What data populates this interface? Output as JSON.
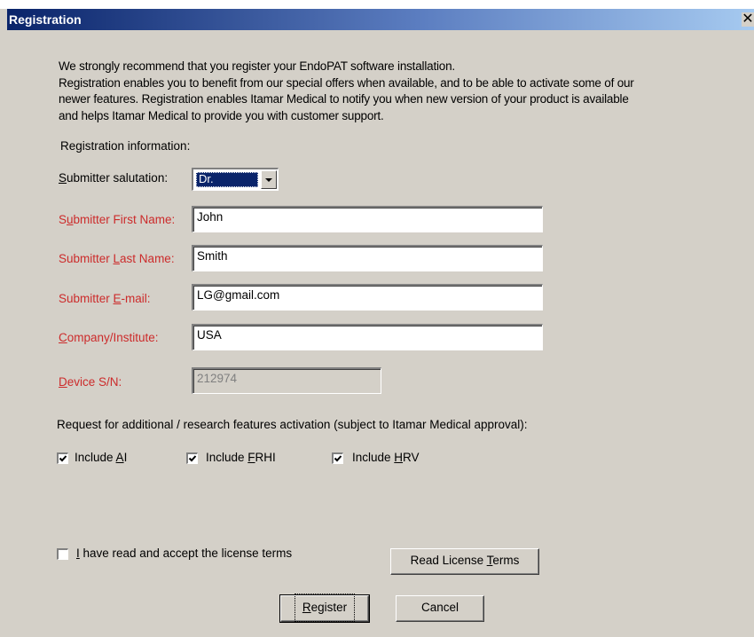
{
  "window": {
    "title": "Registration",
    "close_glyph": "✕"
  },
  "intro": {
    "lines": [
      "We strongly recommend that you register your EndoPAT software installation.",
      "Registration enables you to benefit from our special offers when available, and to be able to activate some of our",
      "newer features. Registration enables Itamar Medical to notify you when new version of your product is available",
      "and helps Itamar Medical to provide you with customer support."
    ]
  },
  "section": {
    "registration_info": "Registration information:"
  },
  "form": {
    "salutation": {
      "label_pre": "",
      "label_ul": "S",
      "label_post": "ubmitter salutation:",
      "value": "Dr."
    },
    "first_name": {
      "label_pre": "S",
      "label_ul": "u",
      "label_post": "bmitter First Name:",
      "value": "John"
    },
    "last_name": {
      "label_pre": "Submitter ",
      "label_ul": "L",
      "label_post": "ast Name:",
      "value": "Smith"
    },
    "email": {
      "label_pre": "Submitter ",
      "label_ul": "E",
      "label_post": "-mail:",
      "value": "LG@gmail.com"
    },
    "company": {
      "label_pre": "",
      "label_ul": "C",
      "label_post": "ompany/Institute:",
      "value": "USA"
    },
    "device_sn": {
      "label_pre": "",
      "label_ul": "D",
      "label_post": "evice S/N:",
      "value": "212974"
    }
  },
  "features": {
    "request_text": "Request for additional / research features activation (subject to Itamar Medical approval):",
    "items": [
      {
        "pre": "Include ",
        "ul": "A",
        "post": "I",
        "checked": true
      },
      {
        "pre": "Include ",
        "ul": "F",
        "post": "RHI",
        "checked": true
      },
      {
        "pre": "Include ",
        "ul": "H",
        "post": "RV",
        "checked": true
      }
    ]
  },
  "license": {
    "accept_ul": "I",
    "accept_post": " have read and accept the license terms",
    "accepted": false,
    "read_pre": "Read License ",
    "read_ul": "T",
    "read_post": "erms"
  },
  "buttons": {
    "register_ul": "R",
    "register_post": "egister",
    "cancel": "Cancel"
  },
  "colors": {
    "required_label": "#cc2b2b",
    "title_bar": "#0a246a",
    "dialog_bg": "#d4d0c8"
  }
}
